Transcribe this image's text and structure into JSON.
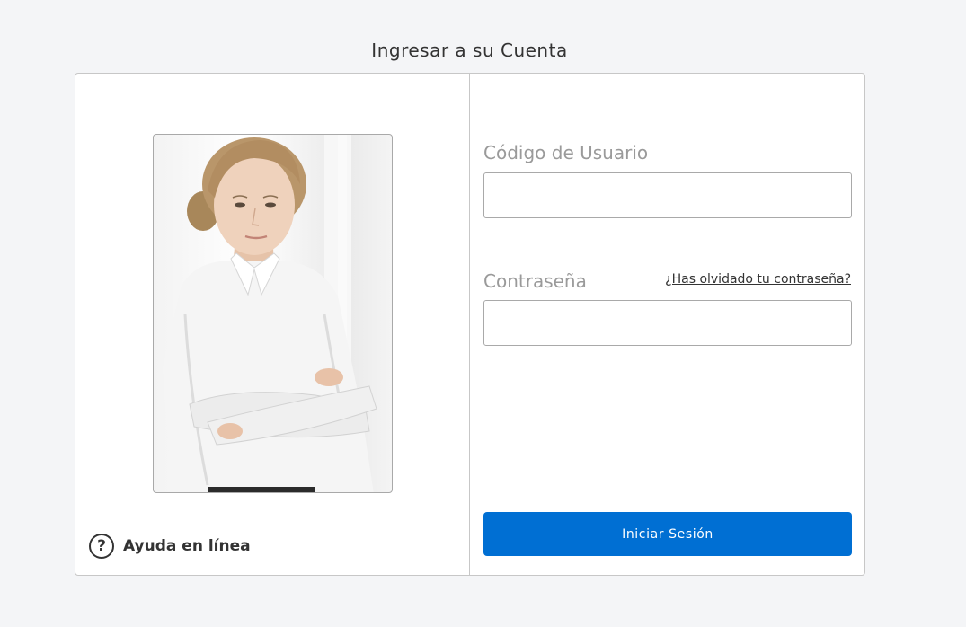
{
  "page": {
    "title": "Ingresar a su Cuenta"
  },
  "login_form": {
    "username_label": "Código de Usuario",
    "username_value": "",
    "password_label": "Contraseña",
    "password_value": "",
    "forgot_password_link": "¿Has olvidado tu contraseña?",
    "submit_label": "Iniciar Sesión"
  },
  "help": {
    "icon": "question-circle-icon",
    "label": "Ayuda en línea"
  },
  "colors": {
    "accent": "#006fd3",
    "background": "#f4f5f7",
    "label_gray": "#9a9a9a"
  }
}
